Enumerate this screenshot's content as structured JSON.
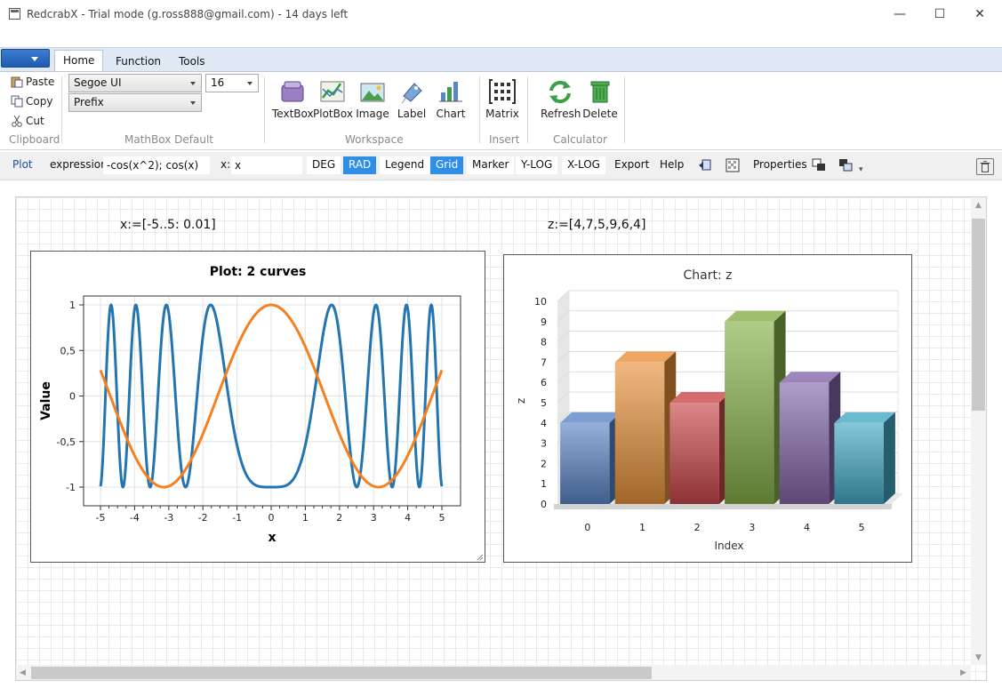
{
  "window": {
    "title": "RedcrabX  -  Trial mode (g.ross888@gmail.com) - 14 days left",
    "minimize": "—",
    "maximize": "☐",
    "close": "✕"
  },
  "tabs": [
    {
      "label": "Home",
      "active": true
    },
    {
      "label": "Function",
      "active": false
    },
    {
      "label": "Tools",
      "active": false
    }
  ],
  "ribbon": {
    "clipboard": {
      "paste": "Paste",
      "copy": "Copy",
      "cut": "Cut",
      "group": "Clipboard"
    },
    "mathbox": {
      "font": "Segoe UI",
      "size": "16",
      "mode": "Prefix",
      "group": "MathBox Default"
    },
    "workspace": {
      "buttons": [
        "TextBox",
        "PlotBox",
        "Image",
        "Label",
        "Chart"
      ],
      "group": "Workspace"
    },
    "insert": {
      "buttons": [
        "Matrix"
      ],
      "group": "Insert"
    },
    "calculator": {
      "buttons": [
        "Refresh",
        "Delete"
      ],
      "group": "Calculator"
    }
  },
  "toolbar": {
    "plot": "Plot",
    "expression_label": "expression",
    "expression_value": "-cos(x^2); cos(x)",
    "x_label": "x:",
    "x_value": "x",
    "deg": "DEG",
    "rad": "RAD",
    "legend": "Legend",
    "grid": "Grid",
    "marker": "Marker",
    "ylog": "Y-LOG",
    "xlog": "X-LOG",
    "export": "Export",
    "help": "Help",
    "properties": "Properties"
  },
  "workspace": {
    "x_def": "x:=[-5..5: 0.01]",
    "z_def": "z:=[4,7,5,9,6,4]"
  },
  "chart_data": [
    {
      "type": "line",
      "title": "Plot: 2 curves",
      "xlabel": "x",
      "ylabel": "Value",
      "xlim": [
        -5,
        5
      ],
      "ylim": [
        -1,
        1
      ],
      "xticks": [
        "-5",
        "-4",
        "-3",
        "-2",
        "-1",
        "0",
        "1",
        "2",
        "3",
        "4",
        "5"
      ],
      "yticks": [
        "1",
        "0,5",
        "0",
        "-0,5",
        "-1"
      ],
      "grid": true,
      "series": [
        {
          "expression": "-cos(x^2)",
          "color": "#2474b0"
        },
        {
          "expression": "cos(x)",
          "color": "#f5801f"
        }
      ]
    },
    {
      "type": "bar",
      "title": "Chart: z",
      "xlabel": "Index",
      "ylabel": "z",
      "categories": [
        "0",
        "1",
        "2",
        "3",
        "4",
        "5"
      ],
      "values": [
        4,
        7,
        5,
        9,
        6,
        4
      ],
      "ylim": [
        0,
        10
      ],
      "yticks": [
        "0",
        "1",
        "2",
        "3",
        "4",
        "5",
        "6",
        "7",
        "8",
        "9",
        "10"
      ],
      "colors": [
        "#5b86c6",
        "#e8913c",
        "#c9474a",
        "#86b04a",
        "#8466aa",
        "#45a9c5"
      ],
      "grid": true
    }
  ]
}
